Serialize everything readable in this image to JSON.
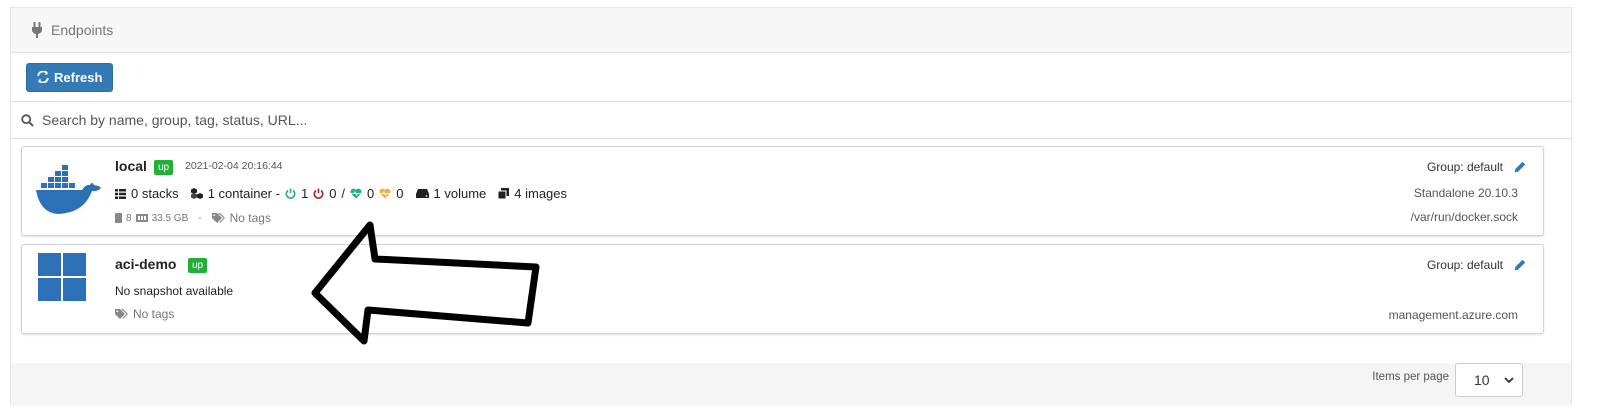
{
  "panel": {
    "title": "Endpoints",
    "icon": "plug-icon"
  },
  "toolbar": {
    "refresh_label": "Refresh",
    "refresh_icon": "refresh-icon"
  },
  "search": {
    "placeholder": "Search by name, group, tag, status, URL..."
  },
  "endpoints": [
    {
      "name": "local",
      "status": "up",
      "timestamp": "2021-02-04 20:16:44",
      "logo": "docker-logo",
      "stacks": "0 stacks",
      "containers": "1 container -",
      "running": "1",
      "stopped": "0",
      "slash": "/",
      "healthy": "0",
      "unhealthy": "0",
      "volumes": "1 volume",
      "images": "4 images",
      "cpu": "8",
      "memory": "33.5 GB",
      "dash": "-",
      "tags": "No tags",
      "group": "Group: default",
      "platform": "Standalone 20.10.3",
      "url": "/var/run/docker.sock"
    },
    {
      "name": "aci-demo",
      "status": "up",
      "logo": "azure-windows-logo",
      "snapshot": "No snapshot available",
      "tags": "No tags",
      "group": "Group: default",
      "url": "management.azure.com"
    }
  ],
  "pagination": {
    "label": "Items per page",
    "value": "10"
  },
  "colors": {
    "primary": "#337ab7",
    "up": "#23ae37",
    "running": "#23ae89",
    "stopped": "#ae2323",
    "healthy": "#23ae89",
    "unhealthy": "#f0ad4e",
    "docker_blue": "#2c71b8"
  }
}
